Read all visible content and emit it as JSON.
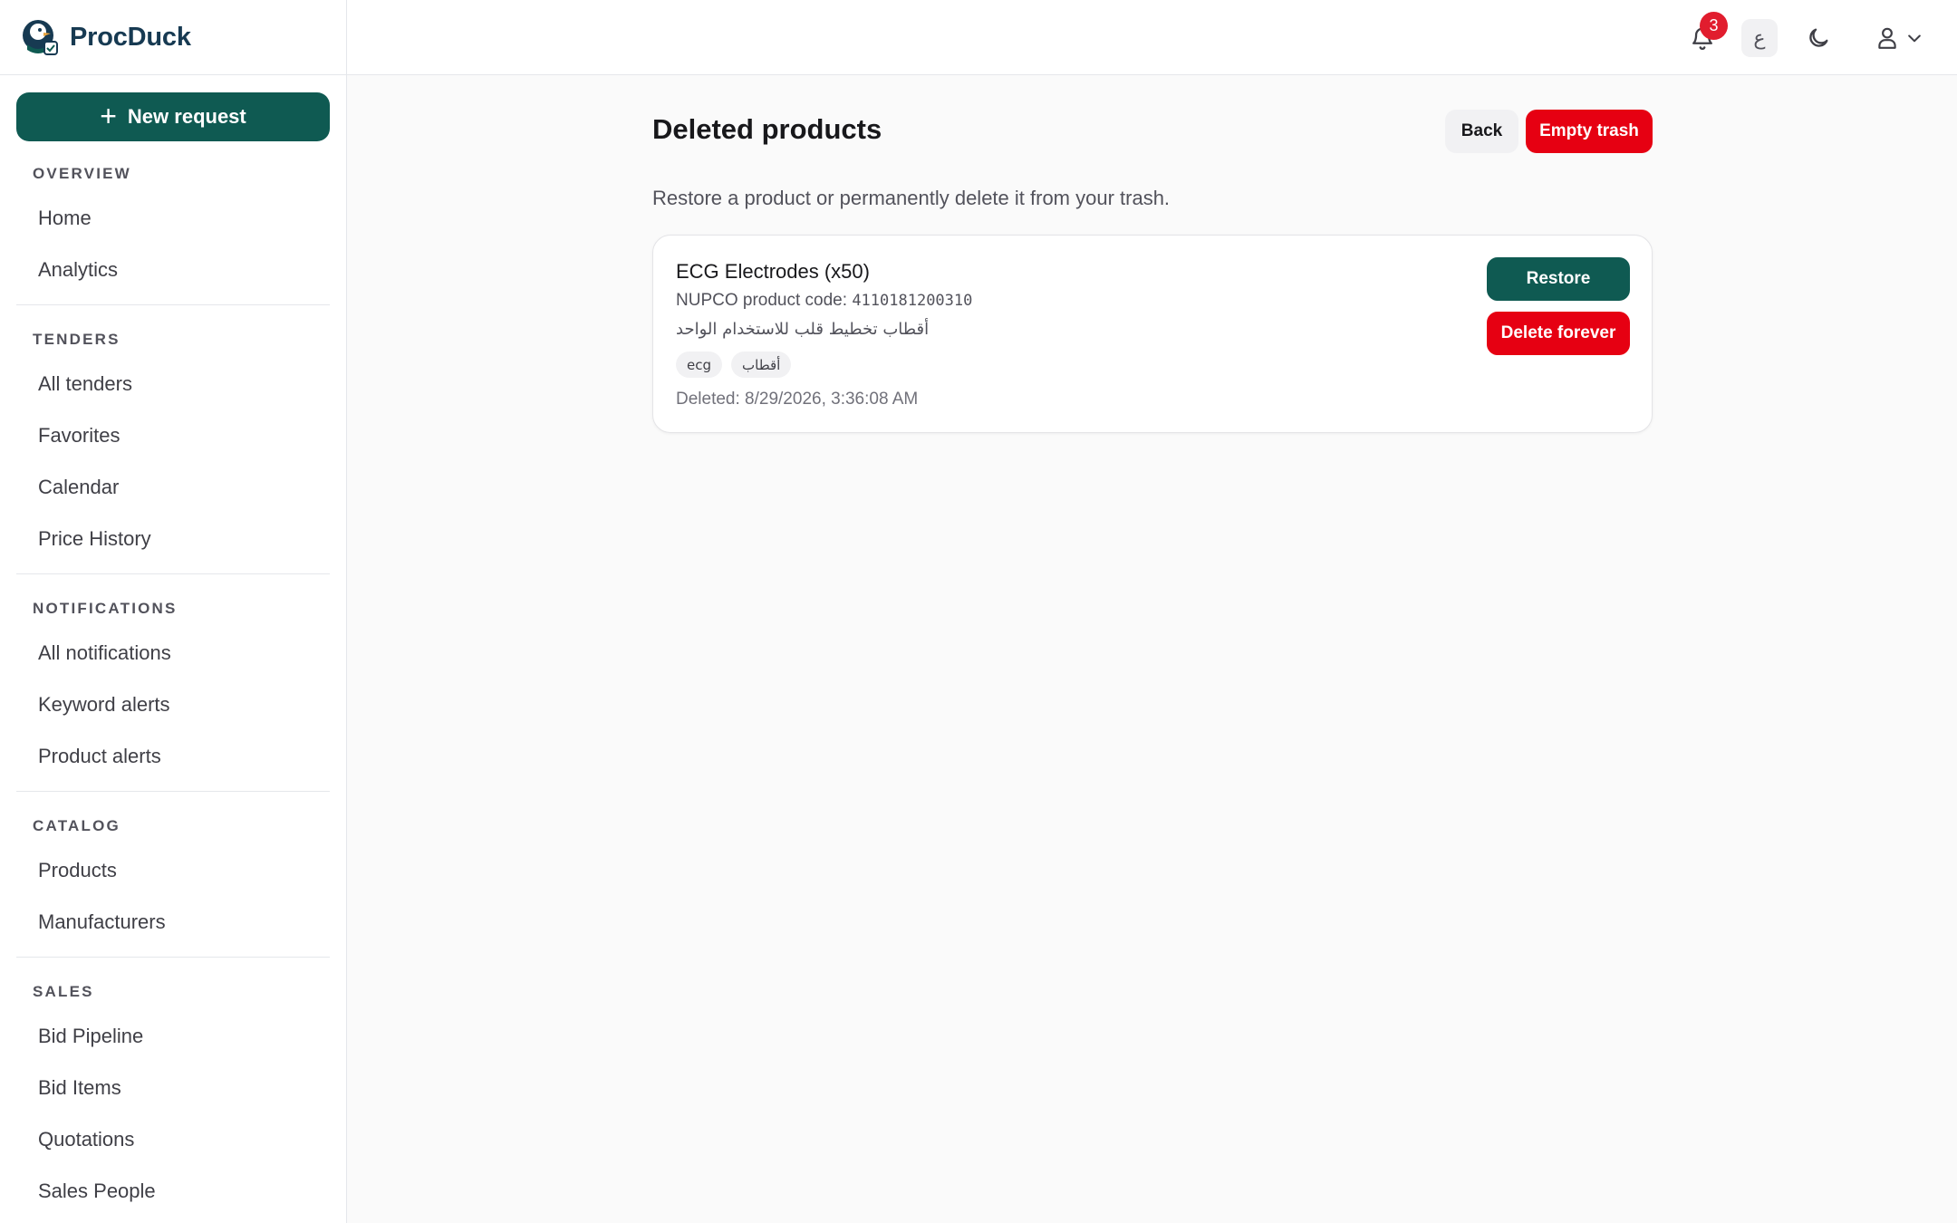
{
  "app": {
    "name": "ProcDuck"
  },
  "sidebar": {
    "new_request_label": "New request",
    "sections": [
      {
        "title": "OVERVIEW",
        "items": [
          "Home",
          "Analytics"
        ]
      },
      {
        "title": "TENDERS",
        "items": [
          "All tenders",
          "Favorites",
          "Calendar",
          "Price History"
        ]
      },
      {
        "title": "NOTIFICATIONS",
        "items": [
          "All notifications",
          "Keyword alerts",
          "Product alerts"
        ]
      },
      {
        "title": "CATALOG",
        "items": [
          "Products",
          "Manufacturers"
        ]
      },
      {
        "title": "SALES",
        "items": [
          "Bid Pipeline",
          "Bid Items",
          "Quotations",
          "Sales People"
        ]
      }
    ]
  },
  "topbar": {
    "notification_count": "3",
    "language_label": "ع",
    "icons": [
      "bell-icon",
      "moon-icon",
      "user-icon",
      "chevron-down-icon"
    ]
  },
  "page": {
    "title": "Deleted products",
    "back_label": "Back",
    "empty_trash_label": "Empty trash",
    "subtitle": "Restore a product or permanently delete it from your trash."
  },
  "deleted_products": [
    {
      "name": "ECG Electrodes (x50)",
      "code_label": "NUPCO product code:",
      "code": "4110181200310",
      "arabic_name": "أقطاب تخطيط قلب للاستخدام الواحد",
      "tags": [
        "ecg",
        "أقطاب"
      ],
      "deleted": "Deleted: 8/29/2026, 3:36:08 AM",
      "restore_label": "Restore",
      "delete_label": "Delete forever"
    }
  ],
  "colors": {
    "primary": "#0f5a52",
    "danger": "#e60012",
    "badge": "#e11d2e",
    "brand_text": "#173a52"
  }
}
